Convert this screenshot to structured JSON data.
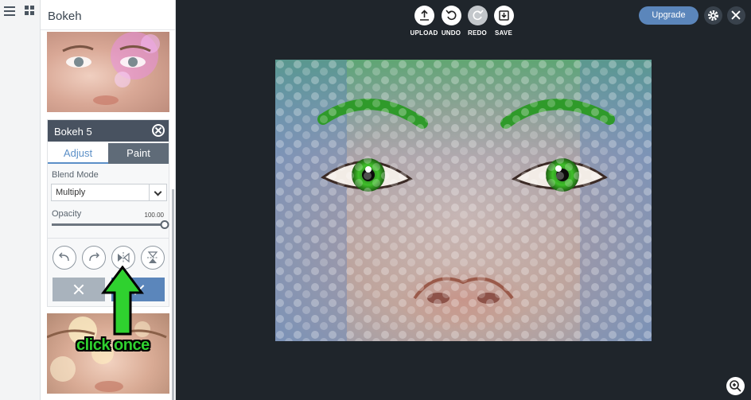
{
  "panel": {
    "title": "Bokeh"
  },
  "effect": {
    "name": "Bokeh 5",
    "tabs": [
      {
        "label": "Adjust",
        "active": true
      },
      {
        "label": "Paint",
        "active": false
      }
    ],
    "blend_mode_label": "Blend Mode",
    "blend_mode_value": "Multiply",
    "opacity_label": "Opacity",
    "opacity_value": "100.00",
    "opacity_fraction": 1.0
  },
  "toolbar": {
    "upload": "UPLOAD",
    "undo": "UNDO",
    "redo": "REDO",
    "save": "SAVE"
  },
  "header": {
    "upgrade": "Upgrade"
  },
  "annotation": {
    "text": "click once"
  },
  "colors": {
    "accent": "#5b86bb",
    "workspace": "#1f252b",
    "annotation": "#2fd12f"
  }
}
